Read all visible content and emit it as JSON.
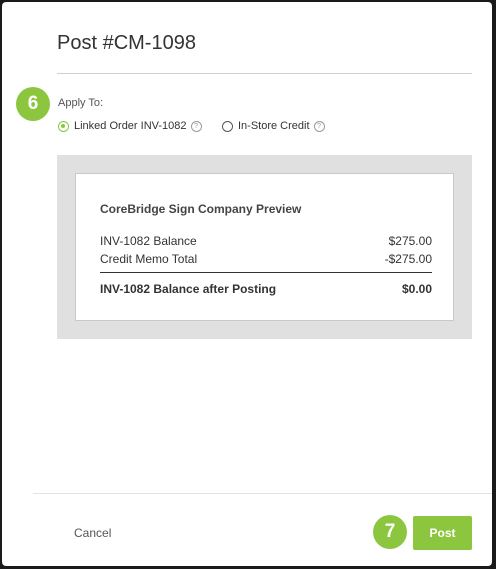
{
  "modal": {
    "title": "Post #CM-1098"
  },
  "steps": {
    "step6": "6",
    "step7": "7"
  },
  "apply_to": {
    "label": "Apply To:",
    "options": [
      {
        "label": "Linked Order INV-1082",
        "selected": true
      },
      {
        "label": "In-Store Credit",
        "selected": false
      }
    ],
    "help_glyph": "?"
  },
  "preview": {
    "company": "CoreBridge Sign Company Preview",
    "rows": [
      {
        "label": "INV-1082 Balance",
        "value": "$275.00"
      },
      {
        "label": "Credit Memo Total",
        "value": "-$275.00"
      }
    ],
    "total": {
      "label": "INV-1082 Balance after Posting",
      "value": "$0.00"
    }
  },
  "footer": {
    "cancel_label": "Cancel",
    "post_label": "Post"
  },
  "colors": {
    "accent": "#8cc63f"
  }
}
